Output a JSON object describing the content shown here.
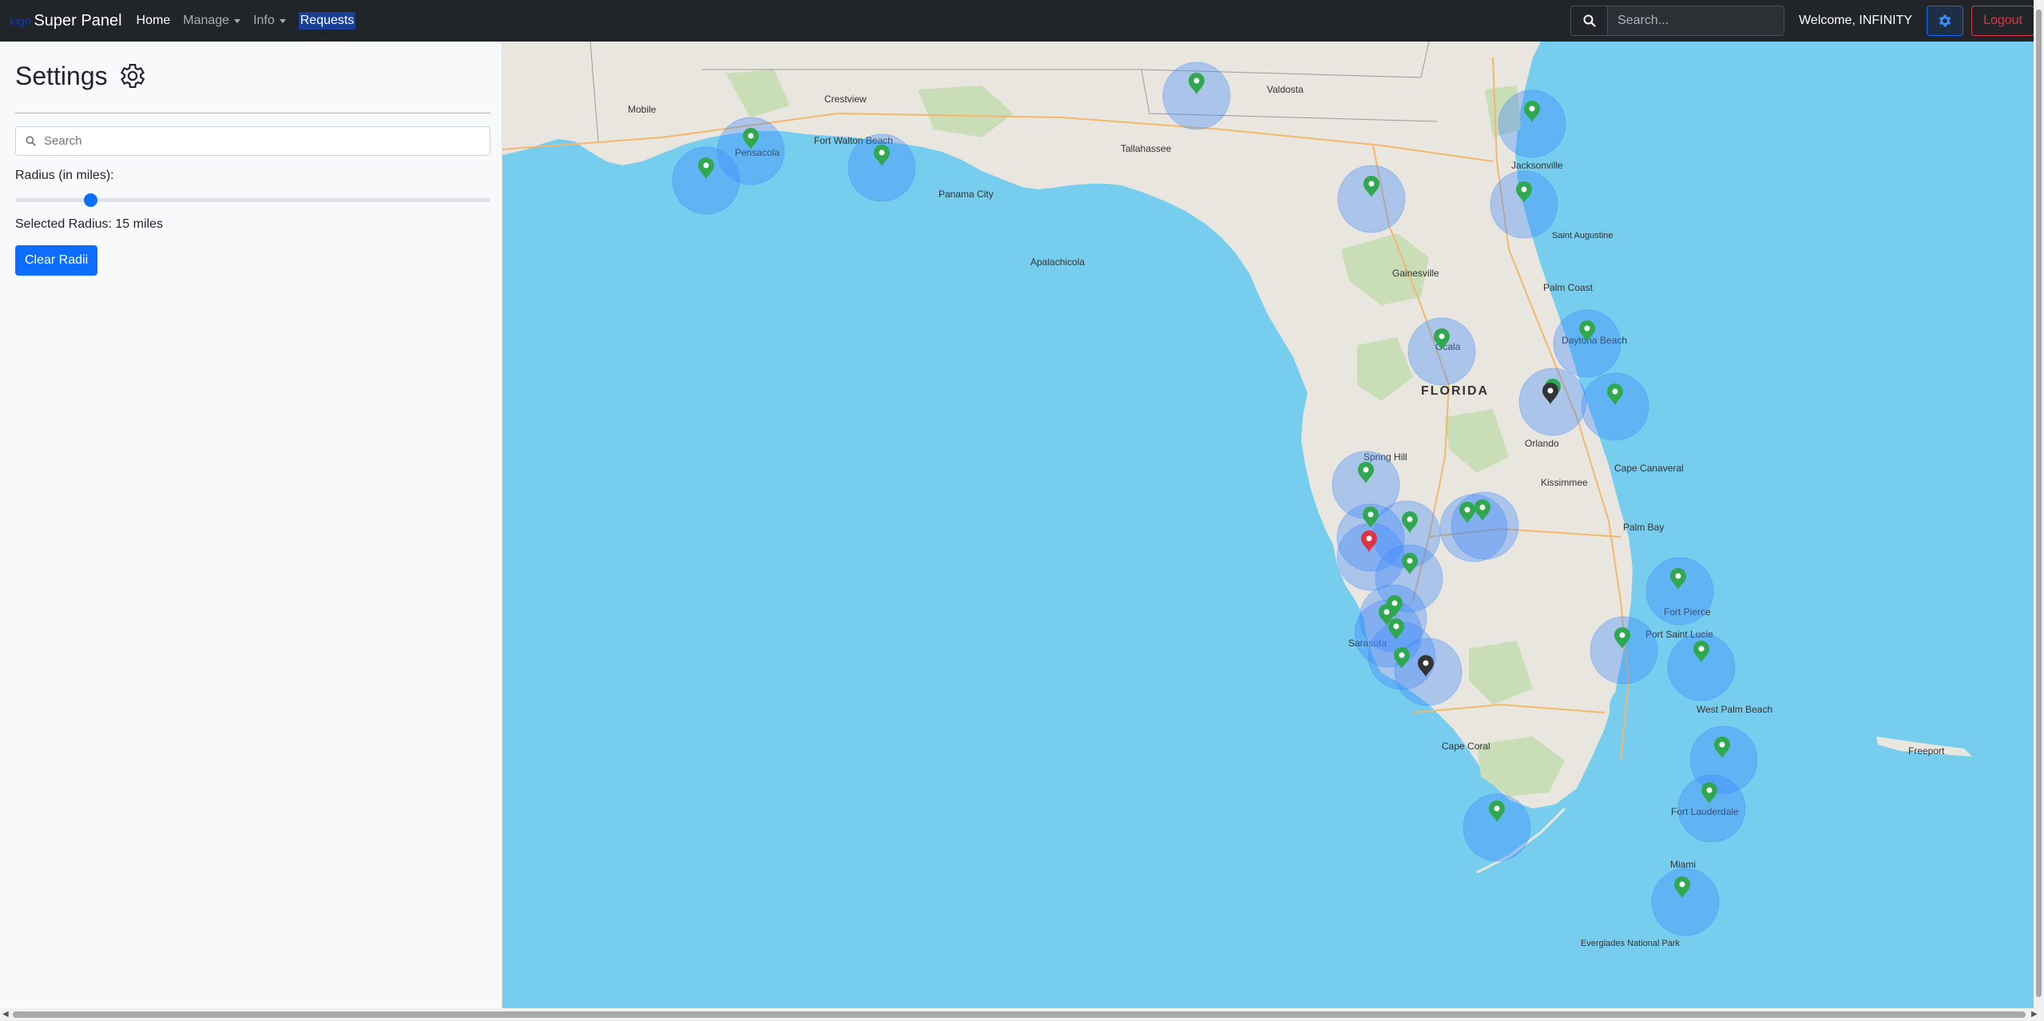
{
  "navbar": {
    "brand_logo": "logo",
    "brand": "Super Panel",
    "links": [
      {
        "label": "Home"
      },
      {
        "label": "Manage"
      },
      {
        "label": "Info"
      },
      {
        "label": "Requests"
      }
    ],
    "search_placeholder": "Search...",
    "welcome": "Welcome, INFINITY",
    "logout": "Logout"
  },
  "sidebar": {
    "title": "Settings",
    "search_placeholder": "Search",
    "radius_label": "Radius (in miles):",
    "radius_value": 15,
    "selected_radius": "Selected Radius: 15 miles",
    "clear_button": "Clear Radii"
  },
  "map": {
    "state_label": "FLORIDA",
    "cities": [
      {
        "name": "Mobile"
      },
      {
        "name": "Crestview"
      },
      {
        "name": "Pensacola"
      },
      {
        "name": "Fort Walton Beach"
      },
      {
        "name": "Panama City"
      },
      {
        "name": "Apalachicola"
      },
      {
        "name": "Tallahassee"
      },
      {
        "name": "Valdosta"
      },
      {
        "name": "Jacksonville"
      },
      {
        "name": "Saint Augustine"
      },
      {
        "name": "Gainesville"
      },
      {
        "name": "Palm Coast"
      },
      {
        "name": "Daytona Beach"
      },
      {
        "name": "Ocala"
      },
      {
        "name": "Orlando"
      },
      {
        "name": "Kissimmee"
      },
      {
        "name": "Cape Canaveral"
      },
      {
        "name": "Spring Hill"
      },
      {
        "name": "Palm Bay"
      },
      {
        "name": "Fort Pierce"
      },
      {
        "name": "Port Saint Lucie"
      },
      {
        "name": "Sarasota"
      },
      {
        "name": "Cape Coral"
      },
      {
        "name": "West Palm Beach"
      },
      {
        "name": "Fort Lauderdale"
      },
      {
        "name": "Miami"
      },
      {
        "name": "Freeport"
      },
      {
        "name": "Everglades National Park"
      }
    ],
    "marker_colors": {
      "active": "#2fa84f",
      "inactive": "#333333",
      "selected": "#dc3545",
      "radius": "#3a86ff"
    }
  }
}
